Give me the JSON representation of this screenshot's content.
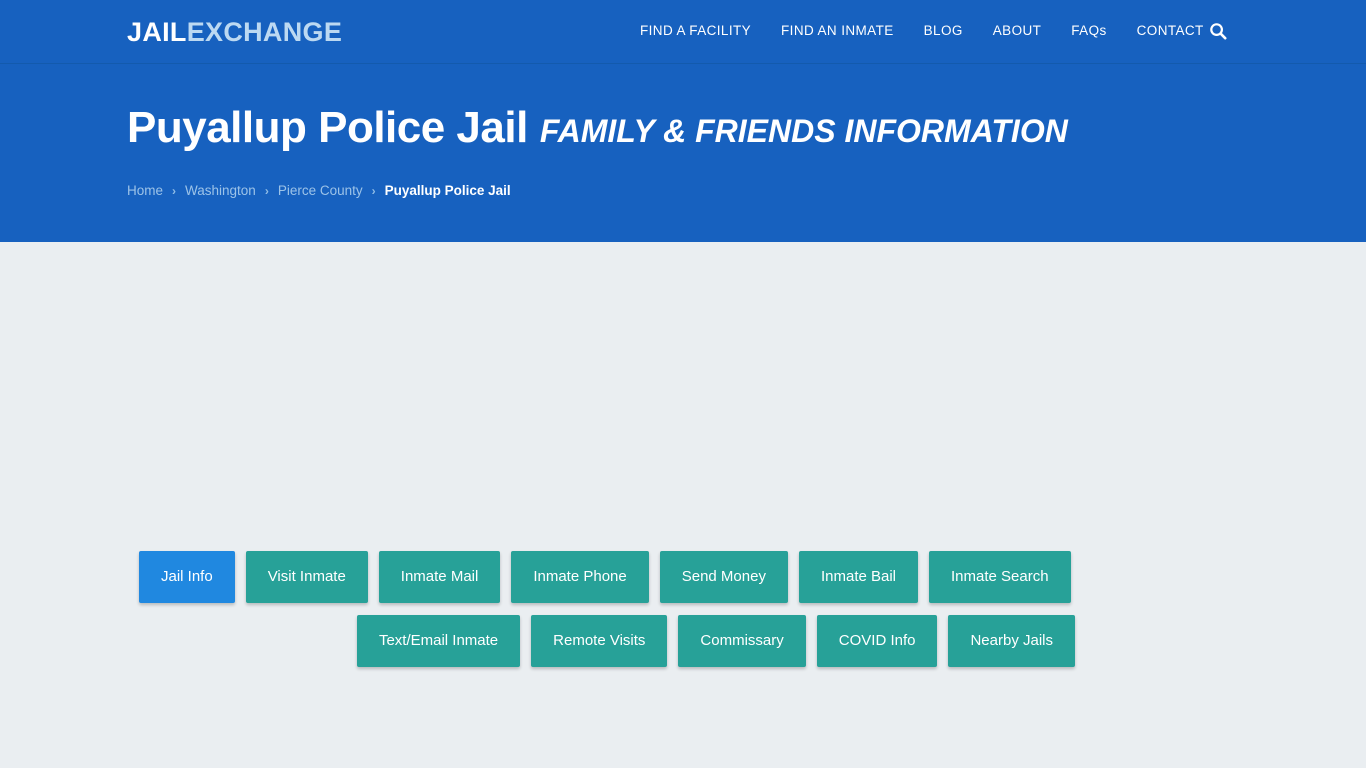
{
  "brand": {
    "part1": "JAIL",
    "part2": "EXCHANGE"
  },
  "nav": {
    "items": [
      {
        "label": "FIND A FACILITY"
      },
      {
        "label": "FIND AN INMATE"
      },
      {
        "label": "BLOG"
      },
      {
        "label": "ABOUT"
      },
      {
        "label": "FAQs"
      },
      {
        "label": "CONTACT"
      }
    ],
    "search_icon": "search-icon"
  },
  "hero": {
    "title": "Puyallup Police Jail",
    "subtitle": "FAMILY & FRIENDS INFORMATION",
    "breadcrumb": [
      {
        "label": "Home",
        "current": false
      },
      {
        "label": "Washington",
        "current": false
      },
      {
        "label": "Pierce County",
        "current": false
      },
      {
        "label": "Puyallup Police Jail",
        "current": true
      }
    ],
    "breadcrumb_separator": "›"
  },
  "tabs": {
    "row1": [
      {
        "label": "Jail Info",
        "active": true
      },
      {
        "label": "Visit Inmate",
        "active": false
      },
      {
        "label": "Inmate Mail",
        "active": false
      },
      {
        "label": "Inmate Phone",
        "active": false
      },
      {
        "label": "Send Money",
        "active": false
      },
      {
        "label": "Inmate Bail",
        "active": false
      },
      {
        "label": "Inmate Search",
        "active": false
      }
    ],
    "row2": [
      {
        "label": "Text/Email Inmate",
        "active": false
      },
      {
        "label": "Remote Visits",
        "active": false
      },
      {
        "label": "Commissary",
        "active": false
      },
      {
        "label": "COVID Info",
        "active": false
      },
      {
        "label": "Nearby Jails",
        "active": false
      }
    ]
  },
  "colors": {
    "header_blue": "#1761bf",
    "active_tab_blue": "#2088e0",
    "tab_teal": "#27a198",
    "body_background": "#eaeef1",
    "brand_accent": "#bcd9f2"
  }
}
